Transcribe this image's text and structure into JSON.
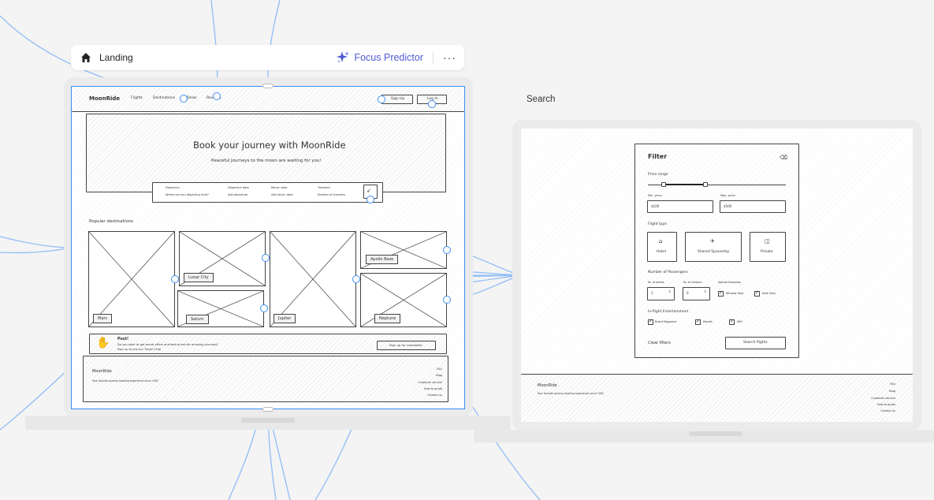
{
  "toolbar": {
    "home_icon": "home-icon",
    "page_title": "Landing",
    "focus_predictor_label": "Focus Predictor",
    "sparkle_icon": "sparkle-icon",
    "more_icon": "more-icon",
    "accent_color": "#4f5bd5"
  },
  "search_frame": {
    "label": "Search"
  },
  "landing": {
    "nav": {
      "logo": "MoonRide",
      "links": [
        "Flights",
        "Destinations",
        "Deals",
        "Reviews"
      ],
      "sign_up": "Sign Up",
      "log_in": "Log In"
    },
    "hero": {
      "title": "Book your journey with MoonRide",
      "subtitle": "Peaceful journeys to the moon are waiting for you!",
      "fields": [
        {
          "label": "Departure",
          "value": "Where are you departing from?"
        },
        {
          "label": "Departure date",
          "value": "Add departure"
        },
        {
          "label": "Return date",
          "value": "Add return date"
        },
        {
          "label": "Travelers",
          "value": "Number of travelers"
        }
      ],
      "search_icon": "rocket-icon"
    },
    "destinations": {
      "heading": "Popular destinations",
      "cards": [
        "Mars",
        "Lunar City",
        "Saturn",
        "Jupiter",
        "Apollo Base",
        "Neptune"
      ]
    },
    "newsletter": {
      "title": "Psst!",
      "line1": "Do you want to get secret offers and best prices for amazing journeys?",
      "line2": "Sign up to join our Travel Club!",
      "button": "Sign up for newsletter",
      "icon": "hand-icon"
    },
    "footer": {
      "brand": "MoonRide",
      "tagline": "Your favorite journey booking experience since 1992",
      "links": [
        "FAQ",
        "Blog",
        "Customer service",
        "How to guide",
        "Contact us"
      ]
    }
  },
  "search": {
    "filter": {
      "title": "Filter",
      "clear_icon": "filter-clear-icon",
      "price_range_label": "Price range",
      "min_price_label": "Min. price",
      "min_price_value": "$100",
      "max_price_label": "Max. price",
      "max_price_value": "$500",
      "flight_type_label": "Flight type",
      "flight_types": [
        {
          "label": "Hotel",
          "icon": "hotel-icon"
        },
        {
          "label": "Shared Spaceship",
          "icon": "spaceship-icon"
        },
        {
          "label": "Private",
          "icon": "private-icon"
        }
      ],
      "passengers_label": "Number of Passengers",
      "adults_label": "Nr. of adults",
      "adults_value": "1",
      "children_label": "Nr. of children",
      "children_value": "0",
      "requests_label": "Special Requests",
      "requests": [
        "Window Seat",
        "Aisle Seat"
      ],
      "entertainment_label": "In-flight Entertainment",
      "entertainment": [
        "Board Magazine",
        "Movies",
        "WiFi"
      ],
      "clear_filters": "Clear filters",
      "search_button": "Search flights"
    },
    "footer": {
      "brand": "MoonRide",
      "tagline": "Your favorite journey booking experience since 1992",
      "links": [
        "FAQ",
        "Blog",
        "Customer service",
        "How to guide",
        "Contact us"
      ]
    }
  }
}
